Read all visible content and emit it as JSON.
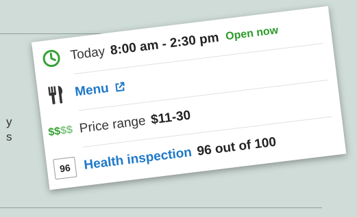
{
  "background": {
    "fragment_1": "y",
    "fragment_2": "s"
  },
  "hours": {
    "day": "Today",
    "time": "8:00 am - 2:30 pm",
    "status": "Open now",
    "status_color": "#2b9a2b",
    "icon": "clock-icon"
  },
  "menu": {
    "label": "Menu",
    "icon": "fork-knife-icon",
    "link_icon": "external-link-icon",
    "link_color": "#1e78c8"
  },
  "price": {
    "symbols_on": "$$",
    "symbols_off": "$$",
    "label": "Price range",
    "value": "$11-30",
    "icon_color": "#35a135"
  },
  "health": {
    "score_badge": "96",
    "label": "Health inspection",
    "value": "96 out of 100"
  }
}
